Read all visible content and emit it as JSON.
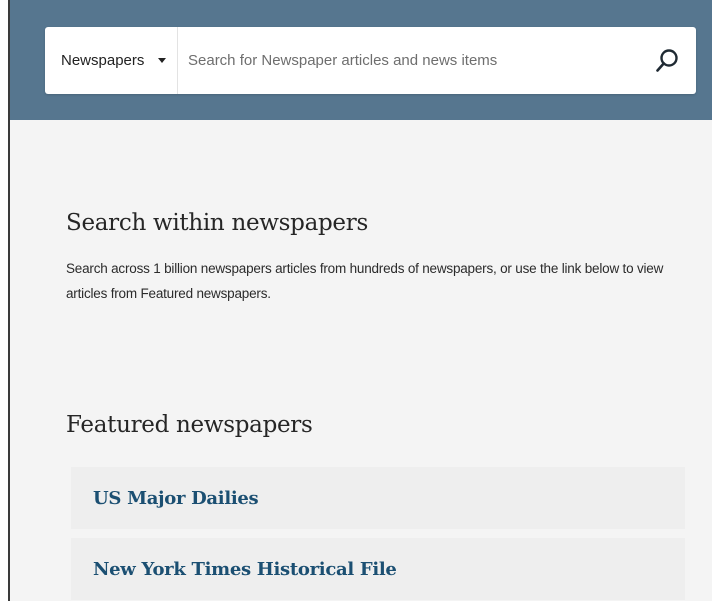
{
  "search": {
    "scope_label": "Newspapers",
    "placeholder": "Search for Newspaper articles and news items",
    "value": ""
  },
  "icons": {
    "scope_caret": "caret-down-icon",
    "search_submit": "magnifier-icon"
  },
  "colors": {
    "header_band": "#56768f",
    "content_background": "#f4f4f4",
    "link": "#1b4f72"
  },
  "search_within": {
    "title": "Search within newspapers",
    "description": "Search across 1 billion newspapers articles from hundreds of newspapers, or use the link below to view articles from Featured newspapers."
  },
  "featured": {
    "title": "Featured newspapers",
    "items": [
      {
        "label": "US Major Dailies"
      },
      {
        "label": "New York Times Historical File"
      }
    ]
  }
}
